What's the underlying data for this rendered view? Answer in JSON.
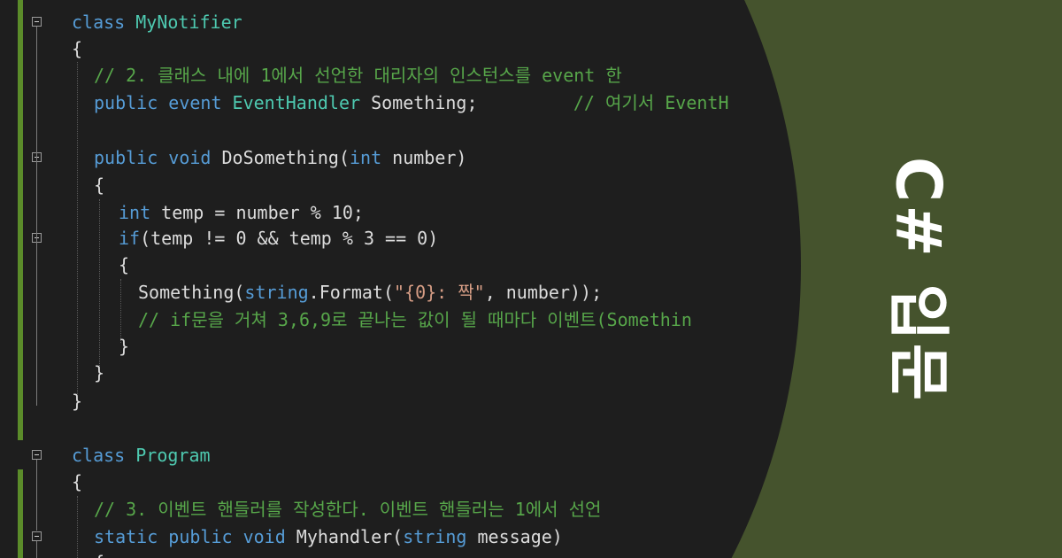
{
  "title": "C# 입문",
  "colors": {
    "background": "#45532d",
    "editor": "#1e1e1e",
    "keyword": "#569cd6",
    "type": "#4ec9b0",
    "comment": "#57a64a",
    "string": "#d69d85"
  },
  "code": {
    "l1": {
      "kw": "class",
      "name": "MyNotifier"
    },
    "l2": "{",
    "l3": "// 2. 클래스 내에 1에서 선언한 대리자의 인스턴스를 event 한",
    "l4": {
      "kw": "public event",
      "type": "EventHandler",
      "rest": " Something;",
      "cmt": "// 여기서 EventH"
    },
    "l6": {
      "kw": "public void",
      "rest": " DoSomething(",
      "kw2": "int",
      "rest2": " number)"
    },
    "l7": "{",
    "l8": {
      "kw": "int",
      "rest": " temp = number % 10;"
    },
    "l9": {
      "kw": "if",
      "rest": "(temp != 0 && temp % 3 == 0)"
    },
    "l10": "{",
    "l11": {
      "a": "Something(",
      "kw": "string",
      "b": ".Format(",
      "str": "\"{0}: 짝\"",
      "c": ", number));"
    },
    "l12": "// if문을 거쳐 3,6,9로 끝나는 값이 될 때마다 이벤트(Somethin",
    "l13": "}",
    "l14": "}",
    "l15": "}",
    "l17": {
      "kw": "class",
      "name": "Program"
    },
    "l18": "{",
    "l19": "// 3. 이벤트 핸들러를 작성한다. 이벤트 핸들러는 1에서 선언",
    "l20": {
      "kw": "static public void",
      "rest": " Myhandler(",
      "kw2": "string",
      "rest2": " message)"
    },
    "l21": "{"
  }
}
